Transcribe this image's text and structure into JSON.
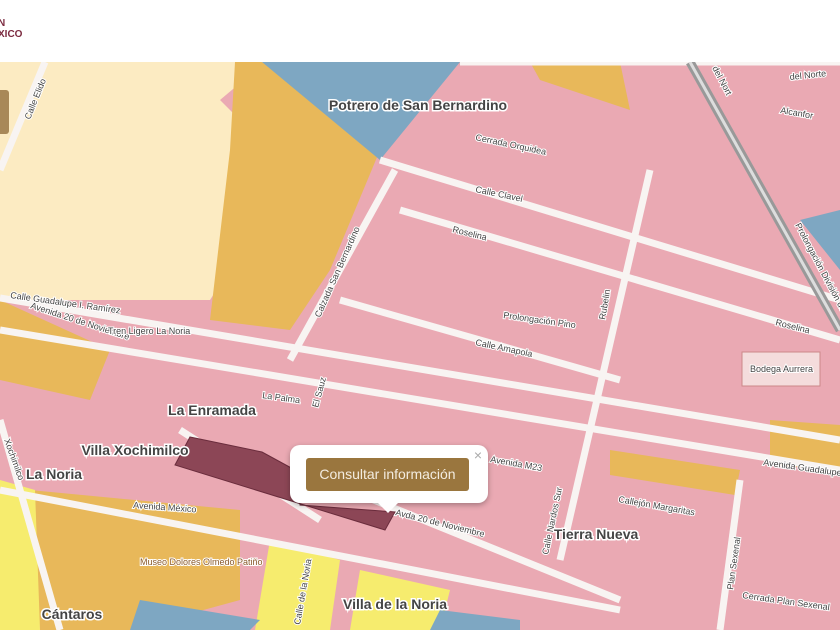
{
  "header": {
    "logo_line1": "N",
    "logo_line2": "XICO"
  },
  "popup": {
    "button": "Consultar información",
    "close": "×"
  },
  "map": {
    "neighborhoods": [
      "Potrero de San Bernardino",
      "La Enramada",
      "Villa Xochimilco",
      "La Noria",
      "Tierra Nueva",
      "Cántaros",
      "Villa de la Noria"
    ],
    "streets": [
      "Calle Elido",
      "Cerrada Orquidea",
      "Calle Clavel",
      "Roselina",
      "Roselina",
      "Calzada San Bernardino",
      "Prolongación Pino",
      "Calle Amapola",
      "Rubelin",
      "Calle Guadalupe I. Ramírez",
      "Avenida 20 de Noviembre",
      "La Palma",
      "El Sauz",
      "Avenida México",
      "Avenida M23",
      "Calle Nardos Sur",
      "Callejón Margaritas",
      "Plan Sexenal",
      "Cerrada Plan Sexenal",
      "Avenida Guadalupe",
      "Avda 20 de Noviembre",
      "Prolongación División del Norte",
      "Alcanfor",
      "del Norte",
      "del Nort",
      "Calle de la Noria",
      "Xochimilco"
    ],
    "pois": [
      "Tren Ligero La Noria",
      "Bodega Aurrera",
      "Museo Dolores Olmedo Patiño"
    ],
    "colors": {
      "residential": "#eaa9b3",
      "water": "#7ea7c2",
      "industrial": "#e8b85a",
      "park": "#fcebc2",
      "yellow": "#f6ec6e",
      "selected": "#8c4656",
      "road": "#f8f4f2"
    }
  }
}
